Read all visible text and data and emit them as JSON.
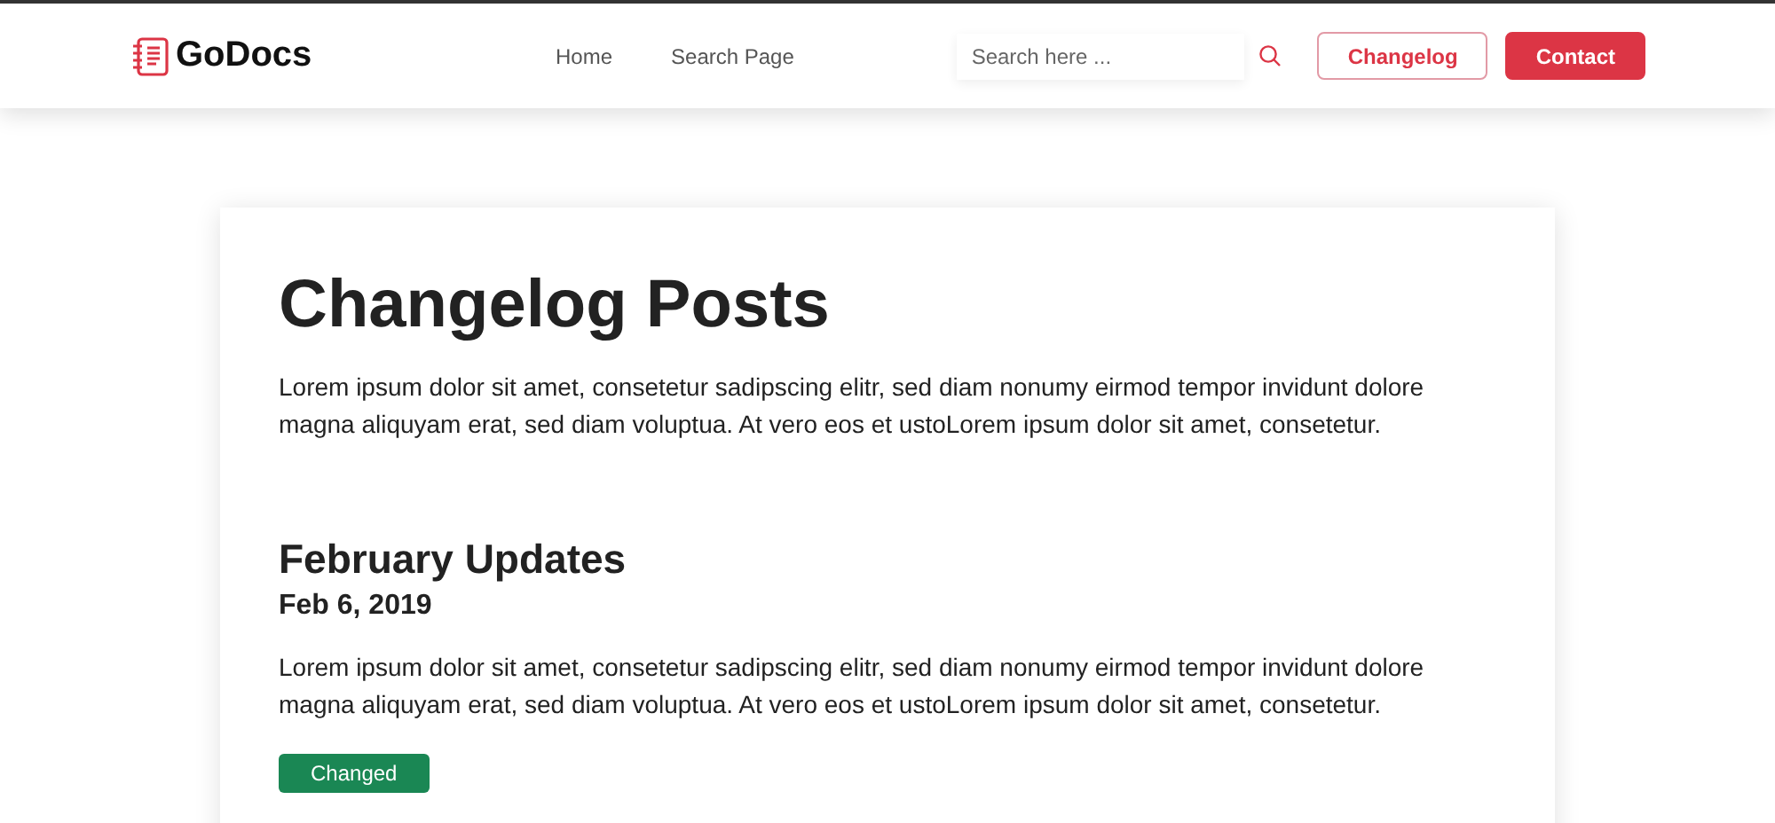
{
  "header": {
    "logo": "GoDocs",
    "nav": [
      {
        "label": "Home"
      },
      {
        "label": "Search Page"
      }
    ],
    "search": {
      "placeholder": "Search here ..."
    },
    "buttons": [
      {
        "label": "Changelog",
        "kind": "outline"
      },
      {
        "label": "Contact",
        "kind": "solid"
      }
    ]
  },
  "page": {
    "title": "Changelog Posts",
    "intro": "Lorem ipsum dolor sit amet, consetetur sadipscing elitr, sed diam nonumy eirmod tempor invidunt dolore magna aliquyam erat, sed diam voluptua. At vero eos et ustoLorem ipsum dolor sit amet, consetetur.",
    "posts": [
      {
        "title": "February Updates",
        "date": "Feb 6, 2019",
        "body": "Lorem ipsum dolor sit amet, consetetur sadipscing elitr, sed diam nonumy eirmod tempor invidunt dolore magna aliquyam erat, sed diam voluptua. At vero eos et ustoLorem ipsum dolor sit amet, consetetur.",
        "tag": {
          "label": "Changed",
          "color": "#1a8754"
        }
      }
    ]
  }
}
